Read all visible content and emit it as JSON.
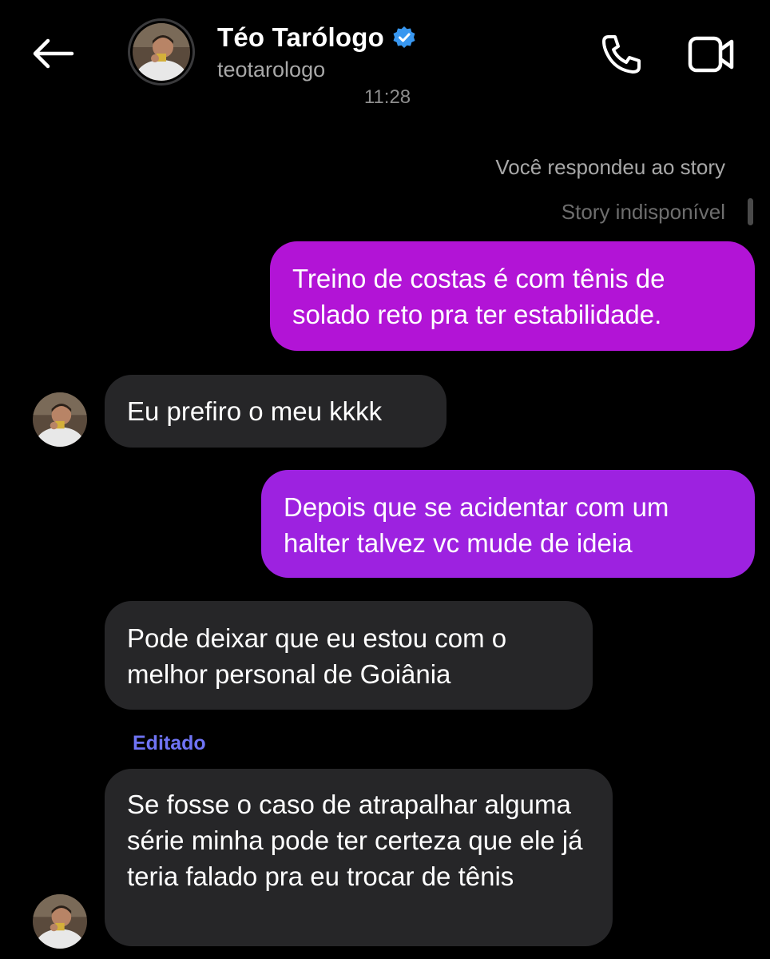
{
  "header": {
    "contact_name": "Téo Tarólogo",
    "contact_handle": "teotarologo",
    "verified_icon": "verified-badge-icon",
    "back_icon": "arrow-left-icon",
    "call_icon": "phone-icon",
    "video_icon": "video-camera-icon"
  },
  "thread": {
    "timestamp": "11:28",
    "story_reply_note": "Você respondeu ao story",
    "story_status": "Story indisponível",
    "edited_label": "Editado",
    "messages": [
      {
        "direction": "outgoing",
        "text": "Treino de costas é com tênis de solado reto pra ter estabilidade."
      },
      {
        "direction": "incoming",
        "text": "Eu prefiro o meu kkkk"
      },
      {
        "direction": "outgoing",
        "text": "Depois que se acidentar com um halter talvez vc mude de ideia"
      },
      {
        "direction": "incoming",
        "text": "Pode deixar que eu estou com o melhor personal de Goiânia"
      },
      {
        "direction": "incoming",
        "text": "Se fosse o caso de atrapalhar alguma série minha pode ter certeza que ele já teria falado pra eu trocar de tênis"
      }
    ]
  },
  "colors": {
    "background": "#000000",
    "incoming_bubble": "#262628",
    "outgoing_bubble_top": "#b214d6",
    "outgoing_bubble_bottom": "#9d22e0",
    "verified_blue": "#3897f0",
    "edited_label": "#6f74f5"
  }
}
